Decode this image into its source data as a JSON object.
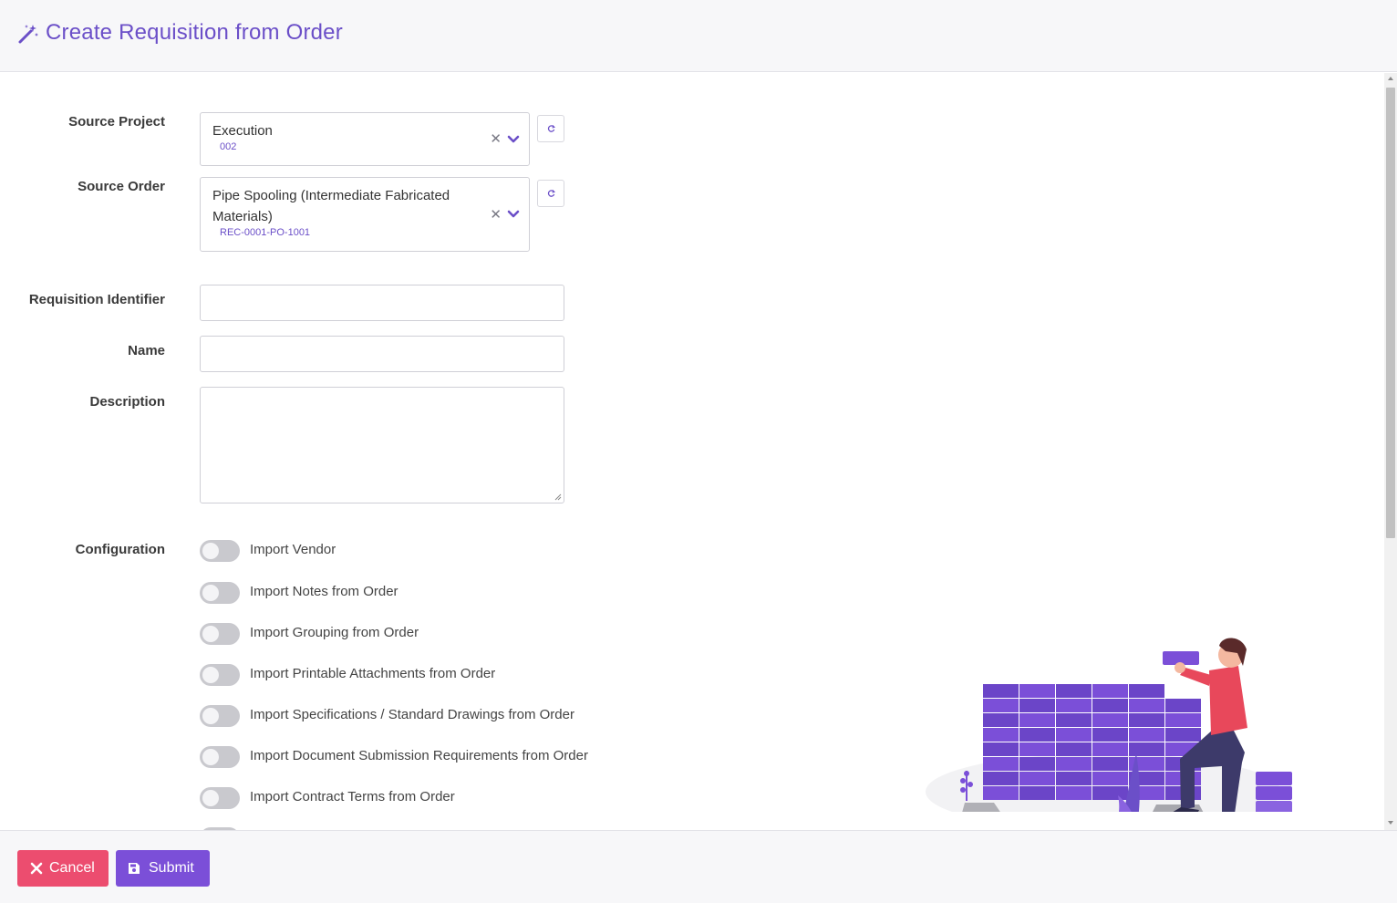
{
  "header": {
    "title": "Create Requisition from Order",
    "icon": "magic-wand-icon"
  },
  "form": {
    "source_project": {
      "label": "Source Project",
      "value": "Execution",
      "sub": "002"
    },
    "source_order": {
      "label": "Source Order",
      "value_line1": "Pipe Spooling (Intermediate Fabricated",
      "value_line2": "Materials)",
      "sub": "REC-0001-PO-1001"
    },
    "requisition_identifier": {
      "label": "Requisition Identifier",
      "value": ""
    },
    "name": {
      "label": "Name",
      "value": ""
    },
    "description": {
      "label": "Description",
      "value": ""
    },
    "configuration": {
      "label": "Configuration",
      "toggles": [
        {
          "label": "Import Vendor",
          "on": false
        },
        {
          "label": "Import Notes from Order",
          "on": false
        },
        {
          "label": "Import Grouping from Order",
          "on": false
        },
        {
          "label": "Import Printable Attachments from Order",
          "on": false
        },
        {
          "label": "Import Specifications / Standard Drawings from Order",
          "on": false
        },
        {
          "label": "Import Document Submission Requirements from Order",
          "on": false
        },
        {
          "label": "Import Contract Terms from Order",
          "on": false
        }
      ]
    }
  },
  "footer": {
    "cancel_label": "Cancel",
    "submit_label": "Submit"
  },
  "colors": {
    "accent": "#6b4fc8",
    "cancel": "#ec4d6f",
    "submit": "#7b4fd8",
    "toggle_off": "#c9c9ce"
  }
}
